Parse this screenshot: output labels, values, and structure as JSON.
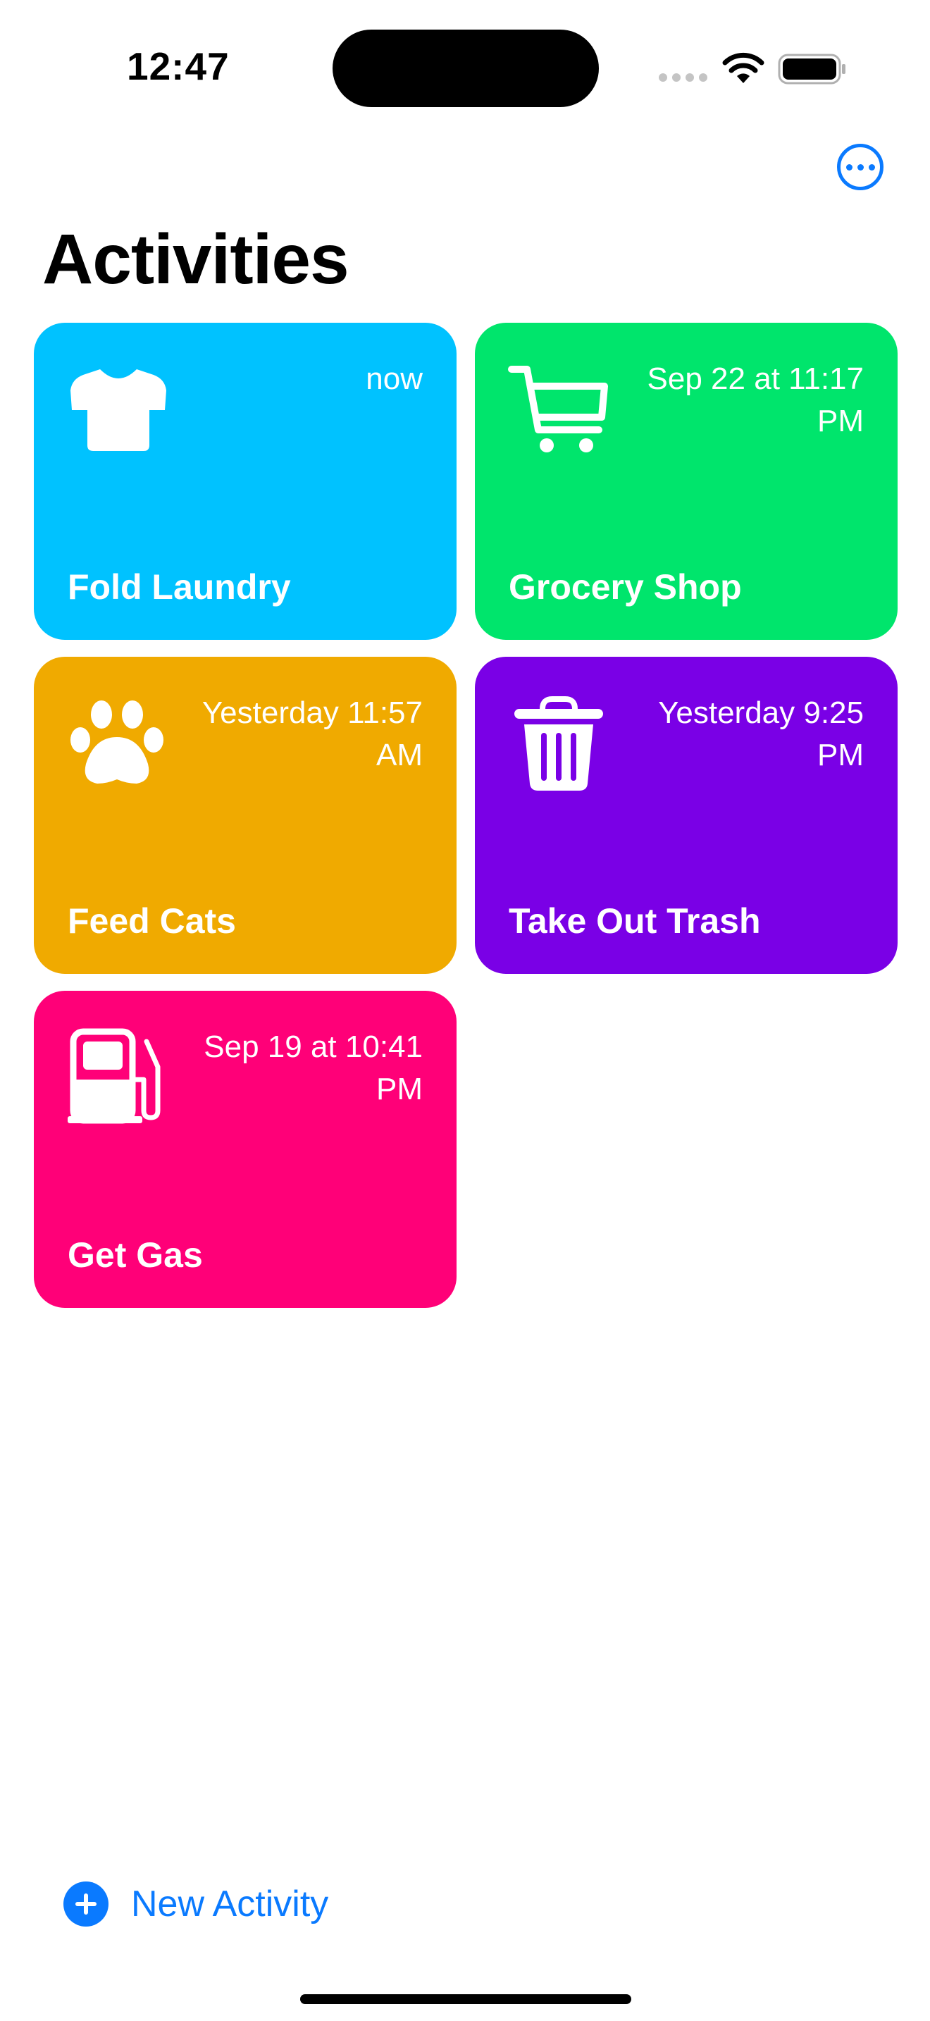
{
  "status_bar": {
    "time": "12:47",
    "icons": [
      "cellular-signal-icon",
      "wifi-icon",
      "battery-icon"
    ]
  },
  "header": {
    "more_icon": "ellipsis-circle-icon",
    "title": "Activities"
  },
  "activities": [
    {
      "title": "Fold Laundry",
      "time": "now",
      "icon": "tshirt-icon",
      "color": "#00c2ff"
    },
    {
      "title": "Grocery Shop",
      "time": "Sep 22 at 11:17 PM",
      "icon": "cart-icon",
      "color": "#00e56c"
    },
    {
      "title": "Feed Cats",
      "time": "Yesterday 11:57 AM",
      "icon": "pawprint-icon",
      "color": "#f0aa00"
    },
    {
      "title": "Take Out Trash",
      "time": "Yesterday 9:25 PM",
      "icon": "trash-icon",
      "color": "#7a00e6"
    },
    {
      "title": "Get Gas",
      "time": "Sep 19 at 10:41 PM",
      "icon": "fuel-pump-icon",
      "color": "#ff0078"
    }
  ],
  "footer": {
    "new_activity_icon": "plus-circle-icon",
    "new_activity_label": "New Activity"
  },
  "colors": {
    "accent": "#0a7aff"
  }
}
